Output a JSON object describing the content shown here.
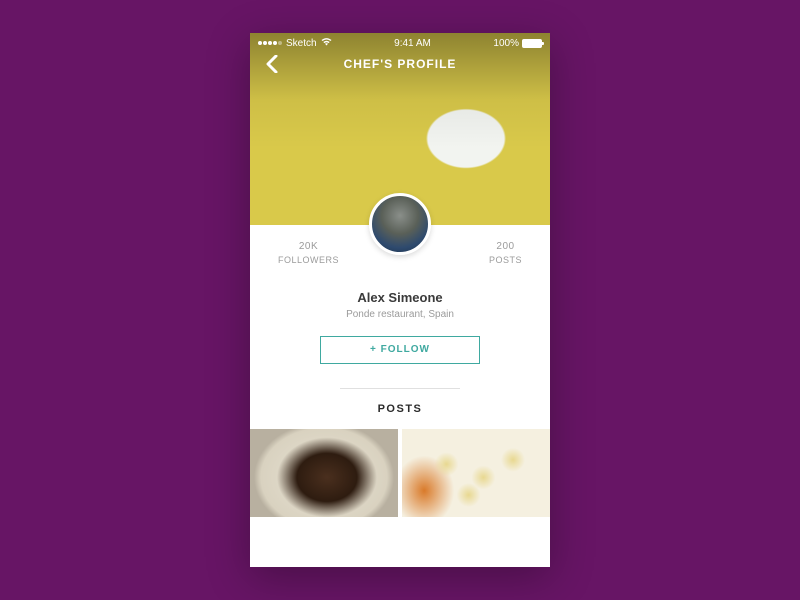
{
  "status": {
    "carrier": "Sketch",
    "time": "9:41 AM",
    "battery_pct": "100%"
  },
  "nav": {
    "title": "CHEF'S PROFILE"
  },
  "stats": {
    "followers_count": "20K",
    "followers_label": "FOLLOWERS",
    "posts_count": "200",
    "posts_label": "POSTS"
  },
  "profile": {
    "name": "Alex Simeone",
    "subtitle": "Ponde restaurant, Spain"
  },
  "actions": {
    "follow_label": "+ FOLLOW"
  },
  "sections": {
    "posts_title": "POSTS"
  }
}
